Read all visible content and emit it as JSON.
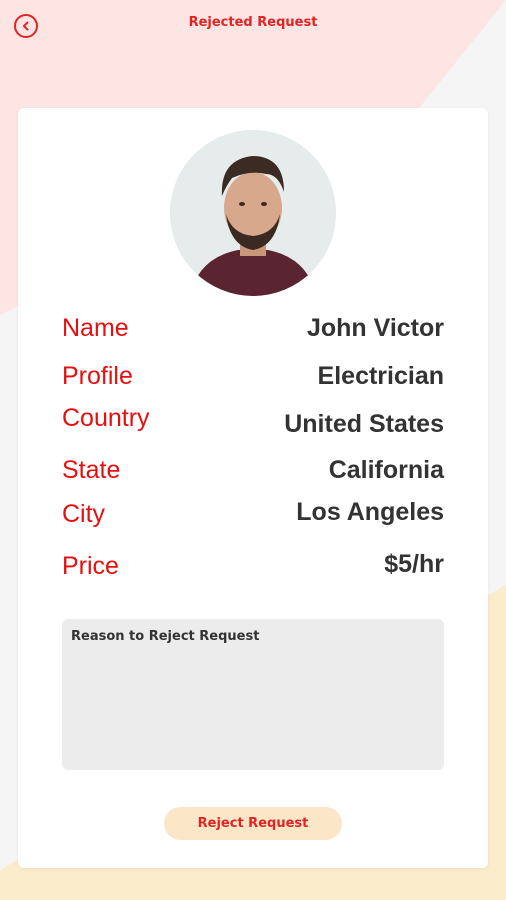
{
  "header": {
    "title": "Rejected Request",
    "back_icon": "chevron-left-icon"
  },
  "profile": {
    "fields": [
      {
        "label": "Name",
        "value": "John Victor"
      },
      {
        "label": "Profile",
        "value": "Electrician"
      },
      {
        "label": "Country",
        "value": "United States"
      },
      {
        "label": "State",
        "value": "California"
      },
      {
        "label": "City",
        "value": "Los Angeles"
      },
      {
        "label": "Price",
        "value": "$5/hr"
      }
    ]
  },
  "reason": {
    "placeholder": "Reason to Reject Request",
    "value": ""
  },
  "actions": {
    "reject_label": "Reject Request"
  },
  "colors": {
    "accent": "#e02424",
    "label_red": "#e60f0f",
    "value_text": "#333333",
    "button_bg": "#fbe6c7",
    "pink_bg": "#fde5e4",
    "yellow_bg": "#fbedcb"
  }
}
